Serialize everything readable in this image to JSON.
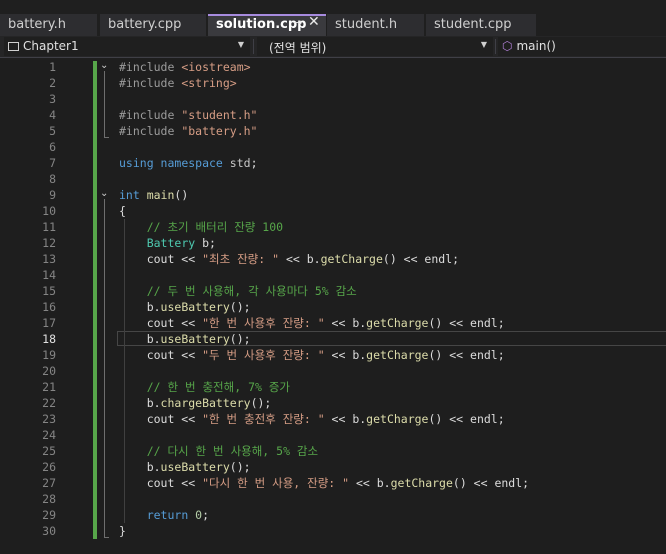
{
  "tabs": [
    {
      "label": "battery.h"
    },
    {
      "label": "battery.cpp"
    },
    {
      "label": "solution.cpp",
      "active": true
    },
    {
      "label": "student.h"
    },
    {
      "label": "student.cpp"
    }
  ],
  "tab_icons": {
    "pin": "pin-icon",
    "close": "close-icon"
  },
  "navbar": {
    "project": "Chapter1",
    "scope": "(전역 범위)",
    "member": "main()"
  },
  "editor": {
    "current_line": 18,
    "lines": [
      {
        "n": "1",
        "tokens": [
          [
            "pp",
            "#include "
          ],
          [
            "str",
            "<iostream>"
          ]
        ]
      },
      {
        "n": "2",
        "tokens": [
          [
            "pp",
            "#include "
          ],
          [
            "str",
            "<string>"
          ]
        ]
      },
      {
        "n": "3",
        "tokens": []
      },
      {
        "n": "4",
        "tokens": [
          [
            "pp",
            "#include "
          ],
          [
            "str",
            "\"student.h\""
          ]
        ]
      },
      {
        "n": "5",
        "tokens": [
          [
            "pp",
            "#include "
          ],
          [
            "str",
            "\"battery.h\""
          ]
        ]
      },
      {
        "n": "6",
        "tokens": []
      },
      {
        "n": "7",
        "tokens": [
          [
            "kw",
            "using "
          ],
          [
            "kw",
            "namespace "
          ],
          [
            "ns",
            "std"
          ],
          [
            "tx",
            ";"
          ]
        ]
      },
      {
        "n": "8",
        "tokens": []
      },
      {
        "n": "9",
        "tokens": [
          [
            "kw",
            "int "
          ],
          [
            "fn",
            "main"
          ],
          [
            "tx",
            "()"
          ]
        ]
      },
      {
        "n": "10",
        "tokens": [
          [
            "tx",
            "{"
          ]
        ]
      },
      {
        "n": "11",
        "tokens": [
          [
            "tx",
            "    "
          ],
          [
            "cm",
            "// 초기 배터리 잔량 100"
          ]
        ]
      },
      {
        "n": "12",
        "tokens": [
          [
            "tx",
            "    "
          ],
          [
            "ty",
            "Battery "
          ],
          [
            "tx",
            "b;"
          ]
        ]
      },
      {
        "n": "13",
        "tokens": [
          [
            "tx",
            "    cout << "
          ],
          [
            "str",
            "\"최초 잔량: \""
          ],
          [
            "tx",
            " << b."
          ],
          [
            "fn",
            "getCharge"
          ],
          [
            "tx",
            "() << endl;"
          ]
        ]
      },
      {
        "n": "14",
        "tokens": []
      },
      {
        "n": "15",
        "tokens": [
          [
            "tx",
            "    "
          ],
          [
            "cm",
            "// 두 번 사용해, 각 사용마다 5% 감소"
          ]
        ]
      },
      {
        "n": "16",
        "tokens": [
          [
            "tx",
            "    b."
          ],
          [
            "fn",
            "useBattery"
          ],
          [
            "tx",
            "();"
          ]
        ]
      },
      {
        "n": "17",
        "tokens": [
          [
            "tx",
            "    cout << "
          ],
          [
            "str",
            "\"한 번 사용후 잔량: \""
          ],
          [
            "tx",
            " << b."
          ],
          [
            "fn",
            "getCharge"
          ],
          [
            "tx",
            "() << endl;"
          ]
        ]
      },
      {
        "n": "18",
        "tokens": [
          [
            "tx",
            "    b."
          ],
          [
            "fn",
            "useBattery"
          ],
          [
            "tx",
            "();"
          ]
        ]
      },
      {
        "n": "19",
        "tokens": [
          [
            "tx",
            "    cout << "
          ],
          [
            "str",
            "\"두 번 사용후 잔량: \""
          ],
          [
            "tx",
            " << b."
          ],
          [
            "fn",
            "getCharge"
          ],
          [
            "tx",
            "() << endl;"
          ]
        ]
      },
      {
        "n": "20",
        "tokens": []
      },
      {
        "n": "21",
        "tokens": [
          [
            "tx",
            "    "
          ],
          [
            "cm",
            "// 한 번 충전해, 7% 증가"
          ]
        ]
      },
      {
        "n": "22",
        "tokens": [
          [
            "tx",
            "    b."
          ],
          [
            "fn",
            "chargeBattery"
          ],
          [
            "tx",
            "();"
          ]
        ]
      },
      {
        "n": "23",
        "tokens": [
          [
            "tx",
            "    cout << "
          ],
          [
            "str",
            "\"한 번 충전후 잔량: \""
          ],
          [
            "tx",
            " << b."
          ],
          [
            "fn",
            "getCharge"
          ],
          [
            "tx",
            "() << endl;"
          ]
        ]
      },
      {
        "n": "24",
        "tokens": []
      },
      {
        "n": "25",
        "tokens": [
          [
            "tx",
            "    "
          ],
          [
            "cm",
            "// 다시 한 번 사용해, 5% 감소"
          ]
        ]
      },
      {
        "n": "26",
        "tokens": [
          [
            "tx",
            "    b."
          ],
          [
            "fn",
            "useBattery"
          ],
          [
            "tx",
            "();"
          ]
        ]
      },
      {
        "n": "27",
        "tokens": [
          [
            "tx",
            "    cout << "
          ],
          [
            "str",
            "\"다시 한 번 사용, 잔량: \""
          ],
          [
            "tx",
            " << b."
          ],
          [
            "fn",
            "getCharge"
          ],
          [
            "tx",
            "() << endl;"
          ]
        ]
      },
      {
        "n": "28",
        "tokens": []
      },
      {
        "n": "29",
        "tokens": [
          [
            "tx",
            "    "
          ],
          [
            "kw",
            "return "
          ],
          [
            "num",
            "0"
          ],
          [
            "tx",
            ";"
          ]
        ]
      },
      {
        "n": "30",
        "tokens": [
          [
            "tx",
            "}"
          ]
        ]
      }
    ]
  },
  "colors": {
    "background": "#1e1e1e",
    "keyword": "#569cd6",
    "string": "#d69d85",
    "comment": "#57a64a",
    "type": "#4ec9b0",
    "function": "#dcdcaa",
    "change_marker": "#57a64a",
    "active_tab_accent": "#a78bde"
  }
}
